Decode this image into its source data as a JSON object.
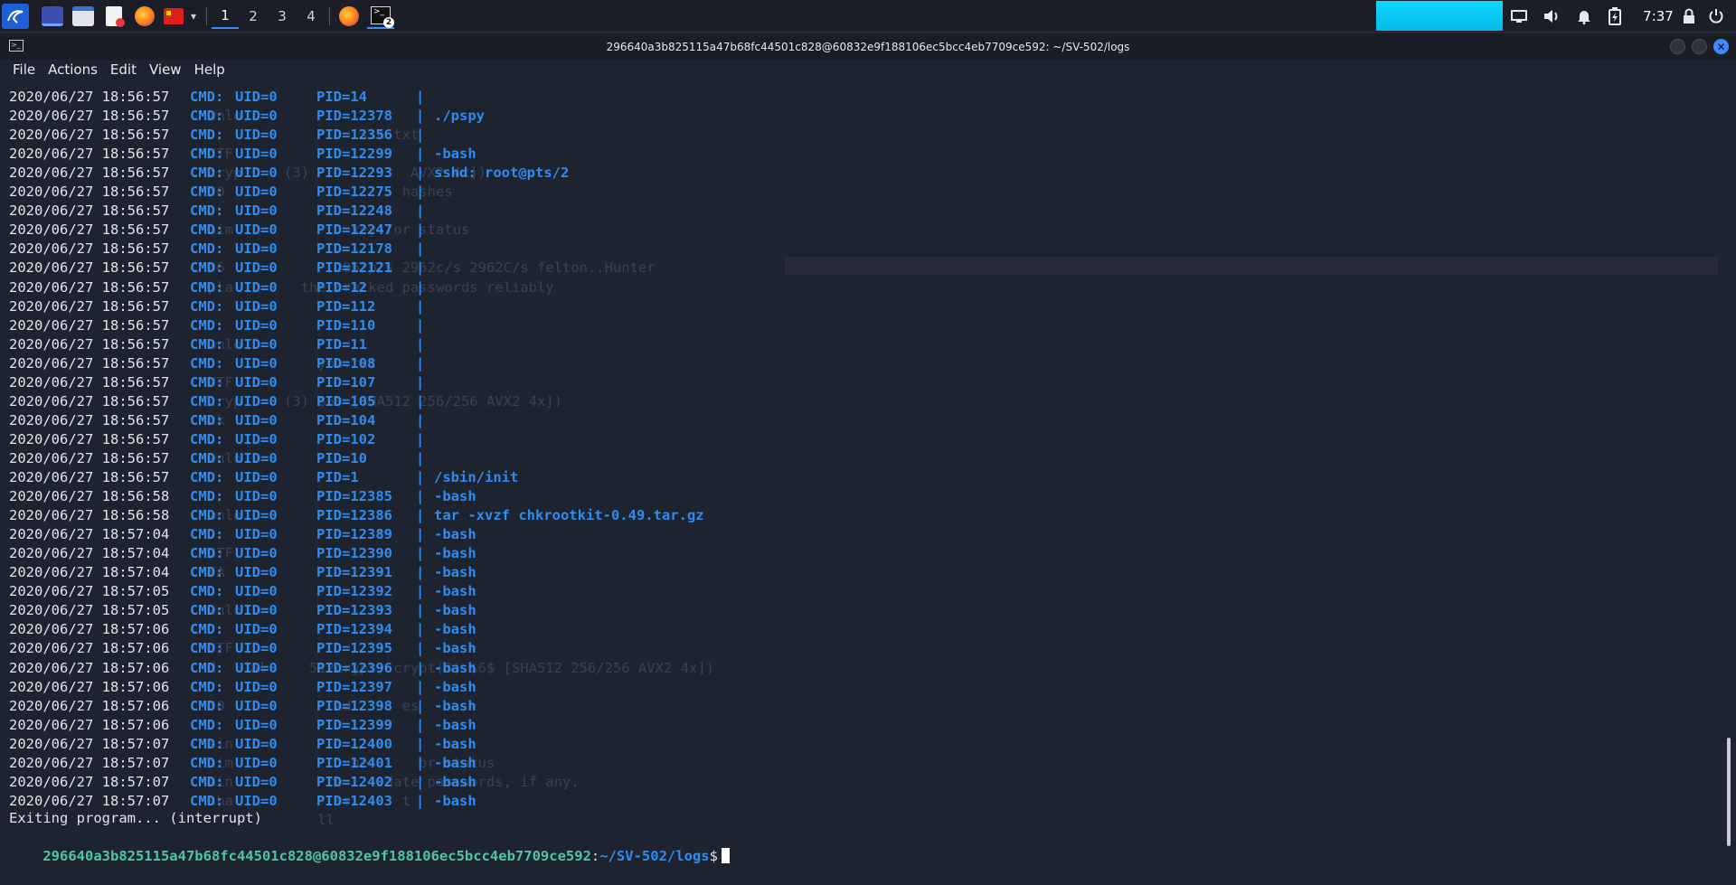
{
  "taskbar": {
    "workspaces": [
      "1",
      "2",
      "3",
      "4"
    ],
    "active_workspace": "1",
    "terminal_badge": "2",
    "clock": "7:37"
  },
  "window": {
    "title": "296640a3b825115a47b68fc44501c828@60832e9f188106ec5bcc4eb7709ce592: ~/SV-502/logs"
  },
  "menu": [
    "File",
    "Actions",
    "Edit",
    "View",
    "Help"
  ],
  "colors": {
    "accent_blue": "#2f8cf0",
    "prompt_green": "#4ec6a4",
    "terminal_bg": "#1e2330",
    "taskbar_meter": "#0fd7ff"
  },
  "terminal": {
    "log_lines": [
      {
        "ts": "2020/06/27 18:56:57",
        "cmd": "CMD:",
        "uid": "UID=0",
        "pid": "PID=14",
        "pipe": "|",
        "proc": ""
      },
      {
        "ts": "2020/06/27 18:56:57",
        "cmd": "CMD:",
        "uid": "UID=0",
        "pid": "PID=12378",
        "pipe": "|",
        "proc": "./pspy"
      },
      {
        "ts": "2020/06/27 18:56:57",
        "cmd": "CMD:",
        "uid": "UID=0",
        "pid": "PID=12356",
        "pipe": "|",
        "proc": ""
      },
      {
        "ts": "2020/06/27 18:56:57",
        "cmd": "CMD:",
        "uid": "UID=0",
        "pid": "PID=12299",
        "pipe": "|",
        "proc": "-bash"
      },
      {
        "ts": "2020/06/27 18:56:57",
        "cmd": "CMD:",
        "uid": "UID=0",
        "pid": "PID=12293",
        "pipe": "|",
        "proc": "sshd: root@pts/2"
      },
      {
        "ts": "2020/06/27 18:56:57",
        "cmd": "CMD:",
        "uid": "UID=0",
        "pid": "PID=12275",
        "pipe": "|",
        "proc": ""
      },
      {
        "ts": "2020/06/27 18:56:57",
        "cmd": "CMD:",
        "uid": "UID=0",
        "pid": "PID=12248",
        "pipe": "|",
        "proc": ""
      },
      {
        "ts": "2020/06/27 18:56:57",
        "cmd": "CMD:",
        "uid": "UID=0",
        "pid": "PID=12247",
        "pipe": "|",
        "proc": ""
      },
      {
        "ts": "2020/06/27 18:56:57",
        "cmd": "CMD:",
        "uid": "UID=0",
        "pid": "PID=12178",
        "pipe": "|",
        "proc": ""
      },
      {
        "ts": "2020/06/27 18:56:57",
        "cmd": "CMD:",
        "uid": "UID=0",
        "pid": "PID=12121",
        "pipe": "|",
        "proc": ""
      },
      {
        "ts": "2020/06/27 18:56:57",
        "cmd": "CMD:",
        "uid": "UID=0",
        "pid": "PID=12",
        "pipe": "|",
        "proc": ""
      },
      {
        "ts": "2020/06/27 18:56:57",
        "cmd": "CMD:",
        "uid": "UID=0",
        "pid": "PID=112",
        "pipe": "|",
        "proc": ""
      },
      {
        "ts": "2020/06/27 18:56:57",
        "cmd": "CMD:",
        "uid": "UID=0",
        "pid": "PID=110",
        "pipe": "|",
        "proc": ""
      },
      {
        "ts": "2020/06/27 18:56:57",
        "cmd": "CMD:",
        "uid": "UID=0",
        "pid": "PID=11",
        "pipe": "|",
        "proc": ""
      },
      {
        "ts": "2020/06/27 18:56:57",
        "cmd": "CMD:",
        "uid": "UID=0",
        "pid": "PID=108",
        "pipe": "|",
        "proc": ""
      },
      {
        "ts": "2020/06/27 18:56:57",
        "cmd": "CMD:",
        "uid": "UID=0",
        "pid": "PID=107",
        "pipe": "|",
        "proc": ""
      },
      {
        "ts": "2020/06/27 18:56:57",
        "cmd": "CMD:",
        "uid": "UID=0",
        "pid": "PID=105",
        "pipe": "|",
        "proc": ""
      },
      {
        "ts": "2020/06/27 18:56:57",
        "cmd": "CMD:",
        "uid": "UID=0",
        "pid": "PID=104",
        "pipe": "|",
        "proc": ""
      },
      {
        "ts": "2020/06/27 18:56:57",
        "cmd": "CMD:",
        "uid": "UID=0",
        "pid": "PID=102",
        "pipe": "|",
        "proc": ""
      },
      {
        "ts": "2020/06/27 18:56:57",
        "cmd": "CMD:",
        "uid": "UID=0",
        "pid": "PID=10",
        "pipe": "|",
        "proc": ""
      },
      {
        "ts": "2020/06/27 18:56:57",
        "cmd": "CMD:",
        "uid": "UID=0",
        "pid": "PID=1",
        "pipe": "|",
        "proc": "/sbin/init"
      },
      {
        "ts": "2020/06/27 18:56:58",
        "cmd": "CMD:",
        "uid": "UID=0",
        "pid": "PID=12385",
        "pipe": "|",
        "proc": "-bash"
      },
      {
        "ts": "2020/06/27 18:56:58",
        "cmd": "CMD:",
        "uid": "UID=0",
        "pid": "PID=12386",
        "pipe": "|",
        "proc": "tar -xvzf chkrootkit-0.49.tar.gz"
      },
      {
        "ts": "2020/06/27 18:57:04",
        "cmd": "CMD:",
        "uid": "UID=0",
        "pid": "PID=12389",
        "pipe": "|",
        "proc": "-bash"
      },
      {
        "ts": "2020/06/27 18:57:04",
        "cmd": "CMD:",
        "uid": "UID=0",
        "pid": "PID=12390",
        "pipe": "|",
        "proc": "-bash"
      },
      {
        "ts": "2020/06/27 18:57:04",
        "cmd": "CMD:",
        "uid": "UID=0",
        "pid": "PID=12391",
        "pipe": "|",
        "proc": "-bash"
      },
      {
        "ts": "2020/06/27 18:57:05",
        "cmd": "CMD:",
        "uid": "UID=0",
        "pid": "PID=12392",
        "pipe": "|",
        "proc": "-bash"
      },
      {
        "ts": "2020/06/27 18:57:05",
        "cmd": "CMD:",
        "uid": "UID=0",
        "pid": "PID=12393",
        "pipe": "|",
        "proc": "-bash"
      },
      {
        "ts": "2020/06/27 18:57:06",
        "cmd": "CMD:",
        "uid": "UID=0",
        "pid": "PID=12394",
        "pipe": "|",
        "proc": "-bash"
      },
      {
        "ts": "2020/06/27 18:57:06",
        "cmd": "CMD:",
        "uid": "UID=0",
        "pid": "PID=12395",
        "pipe": "|",
        "proc": "-bash"
      },
      {
        "ts": "2020/06/27 18:57:06",
        "cmd": "CMD:",
        "uid": "UID=0",
        "pid": "PID=12396",
        "pipe": "|",
        "proc": "-bash"
      },
      {
        "ts": "2020/06/27 18:57:06",
        "cmd": "CMD:",
        "uid": "UID=0",
        "pid": "PID=12397",
        "pipe": "|",
        "proc": "-bash"
      },
      {
        "ts": "2020/06/27 18:57:06",
        "cmd": "CMD:",
        "uid": "UID=0",
        "pid": "PID=12398",
        "pipe": "|",
        "proc": "-bash"
      },
      {
        "ts": "2020/06/27 18:57:06",
        "cmd": "CMD:",
        "uid": "UID=0",
        "pid": "PID=12399",
        "pipe": "|",
        "proc": "-bash"
      },
      {
        "ts": "2020/06/27 18:57:07",
        "cmd": "CMD:",
        "uid": "UID=0",
        "pid": "PID=12400",
        "pipe": "|",
        "proc": "-bash"
      },
      {
        "ts": "2020/06/27 18:57:07",
        "cmd": "CMD:",
        "uid": "UID=0",
        "pid": "PID=12401",
        "pipe": "|",
        "proc": "-bash"
      },
      {
        "ts": "2020/06/27 18:57:07",
        "cmd": "CMD:",
        "uid": "UID=0",
        "pid": "PID=12402",
        "pipe": "|",
        "proc": "-bash"
      },
      {
        "ts": "2020/06/27 18:57:07",
        "cmd": "CMD:",
        "uid": "UID=0",
        "pid": "PID=12403",
        "pipe": "|",
        "proc": "-bash"
      }
    ],
    "exit_message": "Exiting program... (interrupt)",
    "prompt": {
      "host": "296640a3b825115a47b68fc44501c828@60832e9f188106ec5bcc4eb7709ce592",
      "sep": ":",
      "path": "~/SV-502/logs",
      "symbol": "$"
    },
    "ghost_lines": [
      {
        "row": 1,
        "col": 230,
        "text": "wnlo"
      },
      {
        "row": 2,
        "col": 230,
        "text": "                  ssh.txt"
      },
      {
        "row": 3,
        "col": 230,
        "text": "UTF"
      },
      {
        "row": 4,
        "col": 230,
        "text": "cryp     (3)            AVX2 4x])"
      },
      {
        "row": 5,
        "col": 230,
        "text": "00                     hashes"
      },
      {
        "row": 7,
        "col": 230,
        "text": "aim              key for status"
      },
      {
        "row": 9,
        "col": 230,
        "text": "06             2962p/s 2962c/s 2962C/s felton..Hunter"
      },
      {
        "row": 10,
        "col": 230,
        "text": "pla        the cracked passwords reliably"
      },
      {
        "row": 13,
        "col": 230,
        "text": "wnlo"
      },
      {
        "row": 14,
        "col": 230,
        "text": "             you.txt"
      },
      {
        "row": 15,
        "col": 230,
        "text": "UTF"
      },
      {
        "row": 16,
        "col": 230,
        "text": "cryp     (3) $6$ [SHA512 256/256 AVX2 4x])"
      },
      {
        "row": 17,
        "col": 230,
        "text": "ck"
      },
      {
        "row": 19,
        "col": 230,
        "text": "wnlo"
      },
      {
        "row": 22,
        "col": 230,
        "text": "wnlo"
      },
      {
        "row": 23,
        "col": 230,
        "text": "                    t"
      },
      {
        "row": 24,
        "col": 230,
        "text": "UTF"
      },
      {
        "row": 25,
        "col": 230,
        "text": "FA"
      },
      {
        "row": 27,
        "col": 230,
        "text": "wnlo"
      },
      {
        "row": 29,
        "col": 230,
        "text": "UTF"
      },
      {
        "row": 30,
        "col": 230,
        "text": "d    al     512crypt, crypt(3) $6$ [SHA512 256/256 AVX2 4x])"
      },
      {
        "row": 32,
        "col": 230,
        "text": "00             ad      es"
      },
      {
        "row": 34,
        "col": 230,
        "text": "sin"
      },
      {
        "row": 35,
        "col": 230,
        "text": "aim              ne      or status"
      },
      {
        "row": 36,
        "col": 230,
        "text": "ain           re     date passwords, if any."
      },
      {
        "row": 37,
        "col": 230,
        "text": "sha            ss      t"
      },
      {
        "row": 38,
        "col": 230,
        "text": "             ll"
      }
    ]
  }
}
